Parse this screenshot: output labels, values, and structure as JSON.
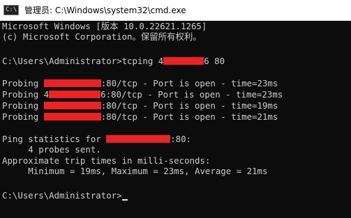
{
  "window": {
    "title": "管理员: C:\\Windows\\system32\\cmd.exe",
    "icon": "cmd-icon",
    "icon_glyph": "C:\\"
  },
  "colors": {
    "terminal_bg": "#0c0c0c",
    "terminal_fg": "#cccccc",
    "redaction": "#ee2222"
  },
  "terminal": {
    "banner_line1": "Microsoft Windows [版本 10.0.22621.1265]",
    "banner_line2": "(c) Microsoft Corporation。保留所有权利。",
    "command_prompt": "C:\\Users\\Administrator>tcping 4",
    "command_host_tail": "6 80",
    "probes": [
      {
        "prefix": "Probing ",
        "suffix": ":80/tcp - Port is open - time=23ms"
      },
      {
        "prefix": "Probing 4",
        "suffix": "6:80/tcp - Port is open - time=23ms"
      },
      {
        "prefix": "Probing ",
        "suffix": ":80/tcp - Port is open - time=19ms"
      },
      {
        "prefix": "Probing ",
        "suffix": ":80/tcp - Port is open - time=21ms"
      }
    ],
    "stats_prefix": "Ping statistics for ",
    "stats_suffix": ":80:",
    "probes_sent": "     4 probes sent.",
    "approx_times": "Approximate trip times in milli-seconds:",
    "min_max_avg": "     Minimum = 19ms, Maximum = 23ms, Average = 21ms",
    "final_prompt": "C:\\Users\\Administrator>"
  }
}
